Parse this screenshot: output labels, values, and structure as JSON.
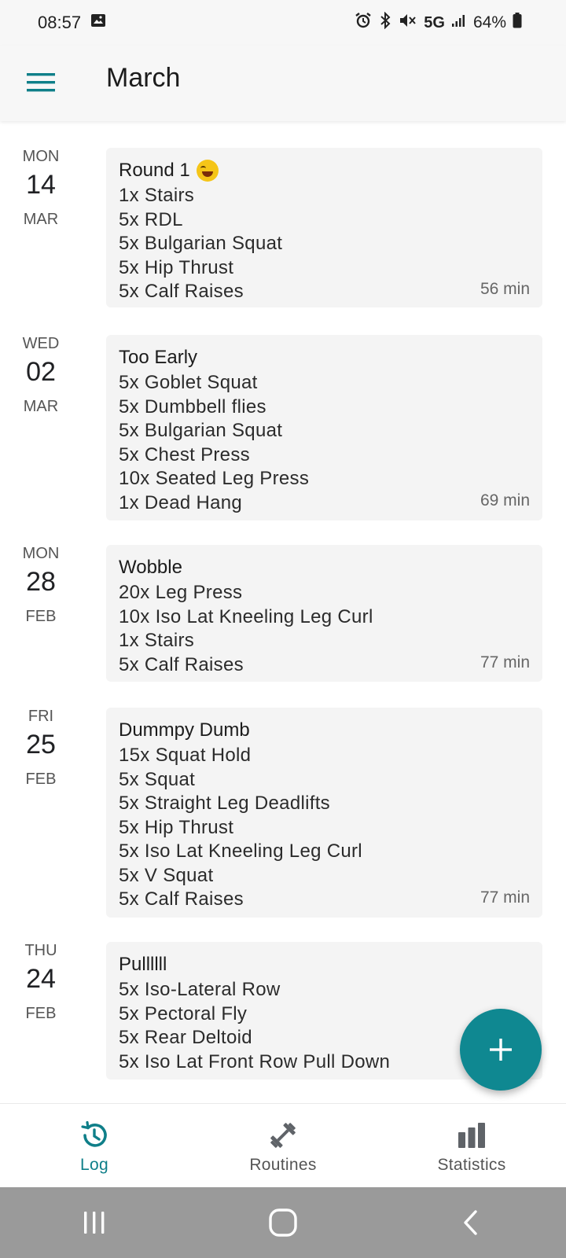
{
  "status_bar": {
    "time": "08:57",
    "network": "5G",
    "battery": "64%"
  },
  "app_bar": {
    "title": "March"
  },
  "entries": [
    {
      "dow": "MON",
      "day": "14",
      "month": "MAR",
      "title": "Round 1",
      "emoji": "rolling-on-floor-laughing",
      "exercises": [
        "1x Stairs",
        "5x RDL",
        "5x Bulgarian Squat",
        "5x Hip Thrust",
        "5x Calf Raises"
      ],
      "duration": "56 min"
    },
    {
      "dow": "WED",
      "day": "02",
      "month": "MAR",
      "title": "Too Early",
      "exercises": [
        "5x Goblet Squat",
        "5x Dumbbell flies",
        "5x Bulgarian Squat",
        "5x Chest Press",
        "10x Seated Leg Press",
        "1x Dead Hang"
      ],
      "duration": "69 min"
    },
    {
      "dow": "MON",
      "day": "28",
      "month": "FEB",
      "title": "Wobble",
      "exercises": [
        "20x Leg Press",
        "10x Iso Lat Kneeling Leg Curl",
        "1x Stairs",
        "5x Calf Raises"
      ],
      "duration": "77 min"
    },
    {
      "dow": "FRI",
      "day": "25",
      "month": "FEB",
      "title": "Dummpy Dumb",
      "exercises": [
        "15x Squat Hold",
        "5x Squat",
        "5x Straight Leg Deadlifts",
        "5x Hip Thrust",
        "5x Iso Lat Kneeling Leg Curl",
        "5x V Squat",
        "5x Calf Raises"
      ],
      "duration": "77 min"
    },
    {
      "dow": "THU",
      "day": "24",
      "month": "FEB",
      "title": "Pullllll",
      "exercises": [
        "5x Iso-Lateral Row",
        "5x Pectoral Fly",
        "5x Rear Deltoid",
        "5x Iso Lat Front Row Pull Down"
      ],
      "duration": ""
    }
  ],
  "fab": {
    "icon": "plus-icon"
  },
  "bottom_nav": {
    "items": [
      {
        "label": "Log",
        "icon": "history-icon",
        "active": true
      },
      {
        "label": "Routines",
        "icon": "dumbbell-icon",
        "active": false
      },
      {
        "label": "Statistics",
        "icon": "bar-chart-icon",
        "active": false
      }
    ]
  },
  "colors": {
    "accent": "#0f8891",
    "card_bg": "#f4f4f4",
    "system_nav_bg": "#9a9a9a"
  }
}
